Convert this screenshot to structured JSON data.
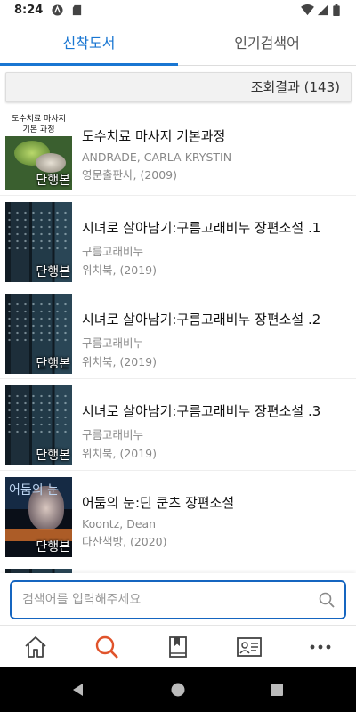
{
  "status": {
    "time": "8:24"
  },
  "tabs": [
    {
      "label": "신착도서",
      "active": true
    },
    {
      "label": "인기검색어",
      "active": false
    }
  ],
  "result": {
    "label": "조회결과 (143)"
  },
  "books": [
    {
      "title": "도수치료 마사지 기본과정",
      "author": "ANDRADE, CARLA-KRYSTIN",
      "publisher": "영문출판사, (2009)",
      "badge": "단행본",
      "cover_text": "도수치료 마사지 기본 과정"
    },
    {
      "title": "시녀로 살아남기:구름고래비누 장편소설 .1",
      "author": "구름고래비누",
      "publisher": "위치북, (2019)",
      "badge": "단행본"
    },
    {
      "title": "시녀로 살아남기:구름고래비누 장편소설 .2",
      "author": "구름고래비누",
      "publisher": "위치북, (2019)",
      "badge": "단행본"
    },
    {
      "title": "시녀로 살아남기:구름고래비누 장편소설 .3",
      "author": "구름고래비누",
      "publisher": "위치북, (2019)",
      "badge": "단행본"
    },
    {
      "title": "어둠의 눈:딘 쿤츠 장편소설",
      "author": "Koontz, Dean",
      "publisher": "다산책방, (2020)",
      "badge": "단행본",
      "cover_text": "어둠의 눈"
    }
  ],
  "search": {
    "placeholder": "검색어를 입력해주세요"
  },
  "colors": {
    "accent": "#1976d2",
    "search_border": "#1565c0",
    "active_nav": "#e0532b"
  },
  "bottom_nav": [
    {
      "icon": "home-icon",
      "active": false
    },
    {
      "icon": "search-icon",
      "active": true
    },
    {
      "icon": "bookmark-book-icon",
      "active": false
    },
    {
      "icon": "id-card-icon",
      "active": false
    },
    {
      "icon": "more-icon",
      "active": false
    }
  ]
}
